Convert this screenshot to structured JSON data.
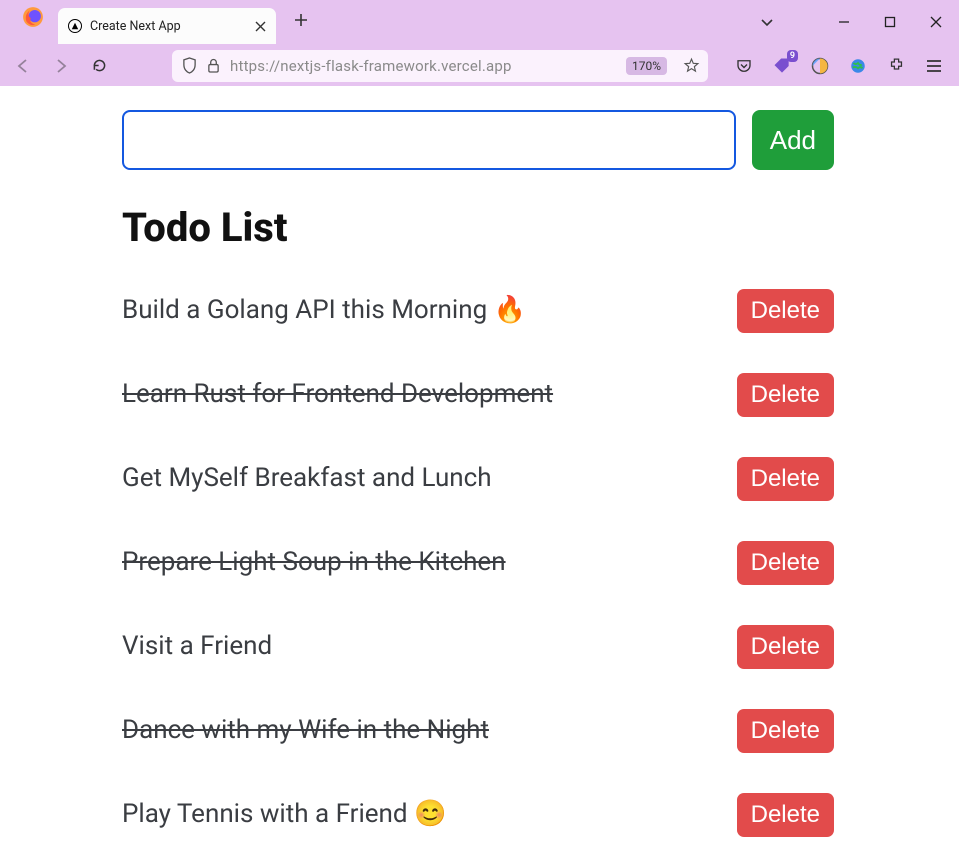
{
  "browser": {
    "tab_title": "Create Next App",
    "url": "https://nextjs-flask-framework.vercel.app",
    "zoom": "170%",
    "notification_count": "9"
  },
  "form": {
    "input_value": "",
    "add_label": "Add"
  },
  "heading": "Todo List",
  "delete_label": "Delete",
  "todos": [
    {
      "text": "Build a Golang API this Morning 🔥",
      "done": false
    },
    {
      "text": "Learn Rust for Frontend Development",
      "done": true
    },
    {
      "text": "Get MySelf Breakfast and Lunch",
      "done": false
    },
    {
      "text": "Prepare Light Soup in the Kitchen",
      "done": true
    },
    {
      "text": "Visit a Friend",
      "done": false
    },
    {
      "text": "Dance with my Wife in the Night",
      "done": true
    },
    {
      "text": "Play Tennis with a Friend 😊",
      "done": false
    }
  ]
}
